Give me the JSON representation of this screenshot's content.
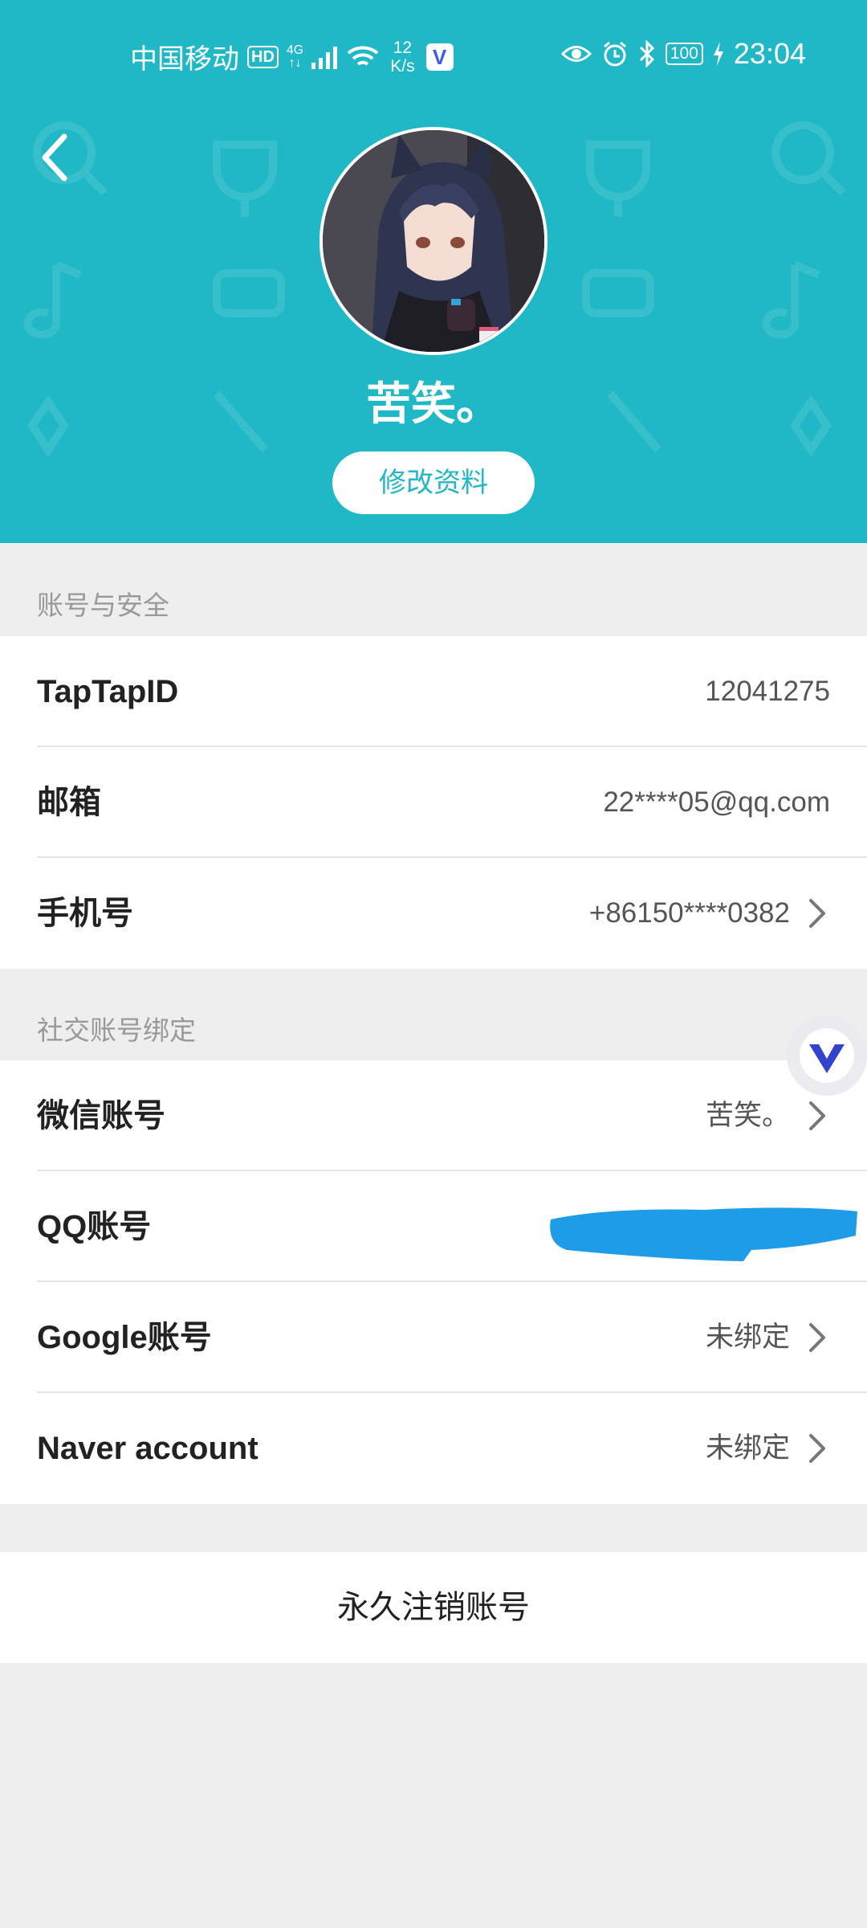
{
  "status_bar": {
    "carrier": "中国移动",
    "hd": "HD",
    "network_top": "4G",
    "network_bottom": "↑↓",
    "speed_value": "12",
    "speed_unit": "K/s",
    "battery": "100",
    "time": "23:04"
  },
  "profile": {
    "username": "苦笑。",
    "edit_label": "修改资料"
  },
  "sections": {
    "account_security_title": "账号与安全",
    "social_binding_title": "社交账号绑定"
  },
  "account_rows": [
    {
      "label": "TapTapID",
      "value": "12041275"
    },
    {
      "label": "邮箱",
      "value": "22****05@qq.com"
    },
    {
      "label": "手机号",
      "value": "+86150****0382"
    }
  ],
  "social_rows": [
    {
      "label": "微信账号",
      "value": "苦笑。"
    },
    {
      "label": "QQ账号",
      "value": ""
    },
    {
      "label": "Google账号",
      "value": "未绑定"
    },
    {
      "label": "Naver account",
      "value": "未绑定"
    }
  ],
  "delete_account_label": "永久注销账号",
  "colors": {
    "header_bg": "#20b8c6",
    "page_bg": "#eeeeee",
    "redaction_blue": "#1f9ce8"
  }
}
